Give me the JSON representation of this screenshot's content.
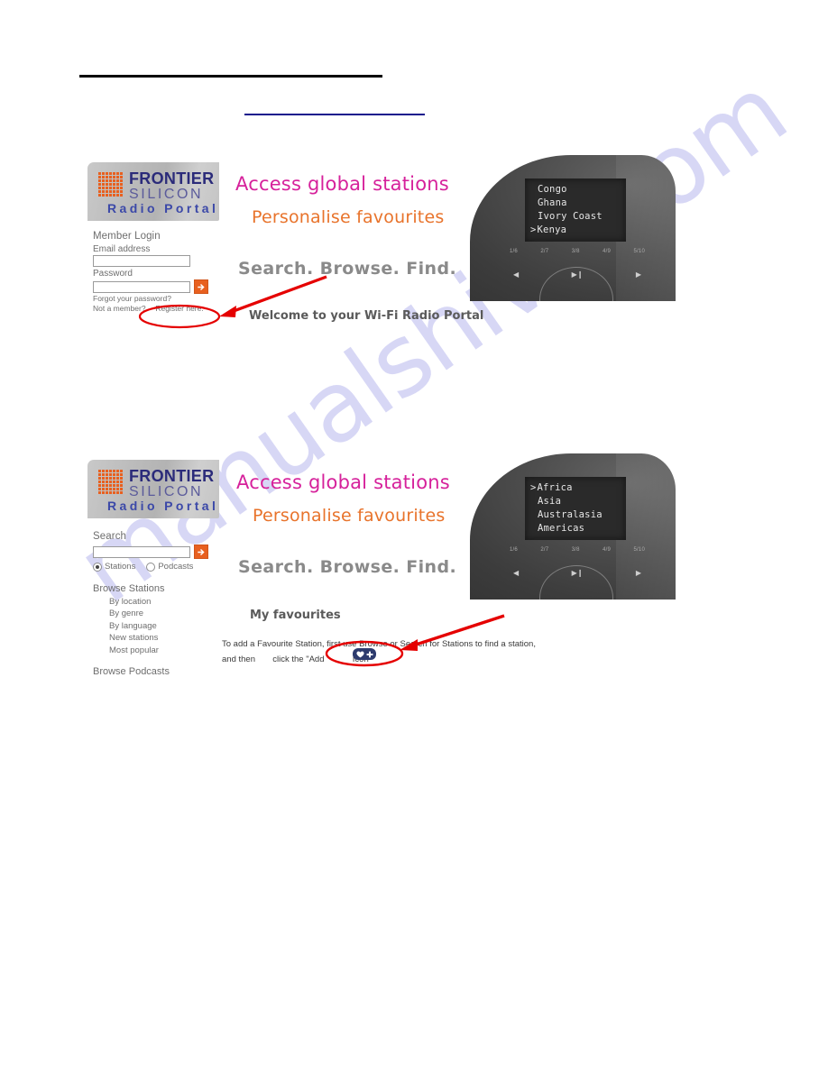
{
  "document": {
    "watermark_text": "manualshive.com",
    "background_color": "#ffffff"
  },
  "rules": {
    "black_rule": "",
    "blue_link_rule": ""
  },
  "colors": {
    "pink": "#d6219b",
    "orange": "#e8732b",
    "grey_slogan": "#8a8a8a",
    "logo_navy": "#2b2b7a",
    "logo_blue": "#3b48a8",
    "button_orange": "#e8601f",
    "annotation_red": "#e50000",
    "badge_navy": "#2d3b6e",
    "blue_rule": "#15158c"
  },
  "figure_one": {
    "portal": {
      "logo": {
        "brand_line_1": "FRONTIER",
        "brand_line_2": "SILICON",
        "product": "Radio Portal"
      },
      "login": {
        "heading": "Member Login",
        "email_label": "Email address",
        "email_value": "",
        "password_label": "Password",
        "password_value": "",
        "submit_icon": "arrow-right-icon",
        "forgot_link": "Forgot your password?",
        "not_member_text": "Not a member?",
        "register_link": "Register here."
      }
    },
    "slogans": {
      "line1": "Access global stations",
      "line2": "Personalise favourites",
      "line3": "Search. Browse. Find.",
      "welcome": "Welcome to your Wi-Fi Radio Portal"
    },
    "device": {
      "screen_lines": [
        {
          "text": "Congo",
          "selected": false
        },
        {
          "text": "Ghana",
          "selected": false
        },
        {
          "text": "Ivory Coast",
          "selected": false
        },
        {
          "text": "Kenya",
          "selected": true
        }
      ],
      "caret": ">",
      "presets": [
        "1/6",
        "2/7",
        "3/8",
        "4/9",
        "5/10"
      ],
      "transport": [
        "prev-icon",
        "play-pause-icon",
        "next-icon"
      ]
    },
    "annotation": {
      "type": "arrow-and-ellipse",
      "target": "Register here."
    }
  },
  "figure_two": {
    "portal": {
      "logo": {
        "brand_line_1": "FRONTIER",
        "brand_line_2": "SILICON",
        "product": "Radio Portal"
      },
      "search": {
        "heading": "Search",
        "query_value": "",
        "submit_icon": "arrow-right-icon",
        "options": [
          {
            "label": "Stations",
            "selected": true
          },
          {
            "label": "Podcasts",
            "selected": false
          }
        ]
      },
      "browse_stations": {
        "heading": "Browse Stations",
        "items": [
          "By location",
          "By genre",
          "By language",
          "New stations",
          "Most popular"
        ]
      },
      "browse_podcasts": {
        "heading": "Browse Podcasts"
      }
    },
    "slogans": {
      "line1": "Access global stations",
      "line2": "Personalise favourites",
      "line3": "Search. Browse. Find."
    },
    "favourites": {
      "heading": "My favourites",
      "body_line_1": "To add a Favourite Station, first use Browse or Search for Stations to find a station,",
      "body_line_2a": "and then",
      "body_line_2b": "click the \"Add",
      "body_line_2c": "Icon",
      "badge_icon": "heart-plus-icon"
    },
    "device": {
      "screen_lines": [
        {
          "text": "Africa",
          "selected": true
        },
        {
          "text": "Asia",
          "selected": false
        },
        {
          "text": "Australasia",
          "selected": false
        },
        {
          "text": "Americas",
          "selected": false
        }
      ],
      "caret": ">",
      "presets": [
        "1/6",
        "2/7",
        "3/8",
        "4/9",
        "5/10"
      ],
      "transport": [
        "prev-icon",
        "play-pause-icon",
        "next-icon"
      ]
    },
    "annotation": {
      "type": "arrow-and-ellipse",
      "target": "heart-plus-icon"
    }
  }
}
